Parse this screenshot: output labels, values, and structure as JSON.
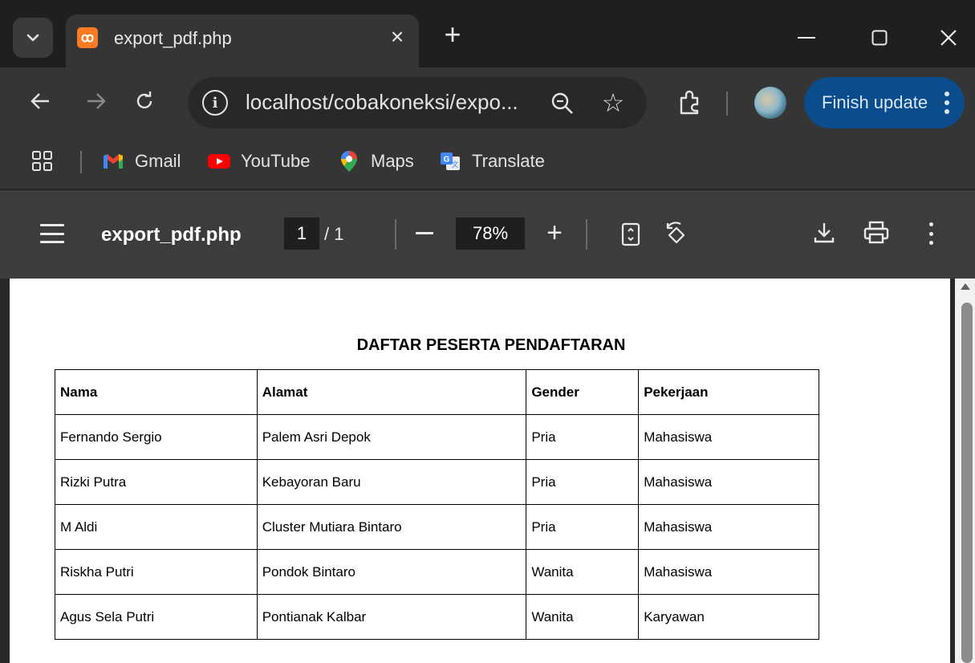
{
  "tab": {
    "title": "export_pdf.php",
    "favicon": "xampp-icon",
    "close": "×",
    "new_tab": "+"
  },
  "window_controls": {
    "minimize": "minimize-icon",
    "maximize": "maximize-icon",
    "close": "close-icon"
  },
  "toolbar": {
    "url": "localhost/cobakoneksi/expo...",
    "finish_update_label": "Finish update"
  },
  "bookmarks": [
    {
      "label": "Gmail",
      "icon": "gmail-icon"
    },
    {
      "label": "YouTube",
      "icon": "youtube-icon"
    },
    {
      "label": "Maps",
      "icon": "maps-icon"
    },
    {
      "label": "Translate",
      "icon": "translate-icon"
    }
  ],
  "pdf_viewer": {
    "file_name": "export_pdf.php",
    "current_page": "1",
    "page_separator": "/ 1",
    "zoom": "78%"
  },
  "document": {
    "title": "DAFTAR PESERTA PENDAFTARAN",
    "headers": [
      "Nama",
      "Alamat",
      "Gender",
      "Pekerjaan"
    ],
    "rows": [
      [
        "Fernando Sergio",
        "Palem Asri Depok",
        "Pria",
        "Mahasiswa"
      ],
      [
        "Rizki Putra",
        "Kebayoran Baru",
        "Pria",
        "Mahasiswa"
      ],
      [
        "M Aldi",
        "Cluster Mutiara Bintaro",
        "Pria",
        "Mahasiswa"
      ],
      [
        "Riskha Putri",
        "Pondok Bintaro",
        "Wanita",
        "Mahasiswa"
      ],
      [
        "Agus Sela Putri",
        "Pontianak Kalbar",
        "Wanita",
        "Karyawan"
      ]
    ]
  },
  "colors": {
    "update_button": "#0b4c8c",
    "tab_favicon": "#fb7a24"
  }
}
